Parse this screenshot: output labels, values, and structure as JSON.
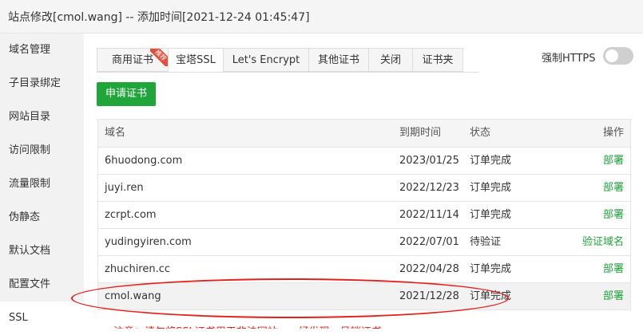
{
  "window": {
    "title": "站点修改[cmol.wang] -- 添加时间[2021-12-24 01:45:47]"
  },
  "sidebar": {
    "items": [
      {
        "label": "域名管理"
      },
      {
        "label": "子目录绑定"
      },
      {
        "label": "网站目录"
      },
      {
        "label": "访问限制"
      },
      {
        "label": "流量限制"
      },
      {
        "label": "伪静态"
      },
      {
        "label": "默认文档"
      },
      {
        "label": "配置文件"
      },
      {
        "label": "SSL"
      }
    ]
  },
  "tabs": [
    {
      "label": "商用证书",
      "badge": "推荐"
    },
    {
      "label": "宝塔SSL"
    },
    {
      "label": "Let's Encrypt"
    },
    {
      "label": "其他证书"
    },
    {
      "label": "关闭"
    },
    {
      "label": "证书夹"
    }
  ],
  "https": {
    "label": "强制HTTPS",
    "enabled": false
  },
  "apply_button": {
    "label": "申请证书"
  },
  "table": {
    "headers": {
      "domain": "域名",
      "expire": "到期时间",
      "status": "状态",
      "action": "操作"
    },
    "rows": [
      {
        "domain": "6huodong.com",
        "expire": "2023/01/25",
        "status": "订单完成",
        "action": "部署"
      },
      {
        "domain": "juyi.ren",
        "expire": "2022/12/23",
        "status": "订单完成",
        "action": "部署"
      },
      {
        "domain": "zcrpt.com",
        "expire": "2022/11/14",
        "status": "订单完成",
        "action": "部署"
      },
      {
        "domain": "yudingyiren.com",
        "expire": "2022/07/01",
        "status": "待验证",
        "action": "验证域名"
      },
      {
        "domain": "zhuchiren.cc",
        "expire": "2022/04/28",
        "status": "订单完成",
        "action": "部署"
      },
      {
        "domain": "cmol.wang",
        "expire": "2021/12/28",
        "status": "订单完成",
        "action": "部署"
      }
    ]
  },
  "note": {
    "text": "注意：请勿将SSL证书用于非法网站，一经发现，吊销证书"
  },
  "colors": {
    "accent": "#20a53a",
    "highlight": "#e2211c",
    "badge": "#e2503c"
  }
}
